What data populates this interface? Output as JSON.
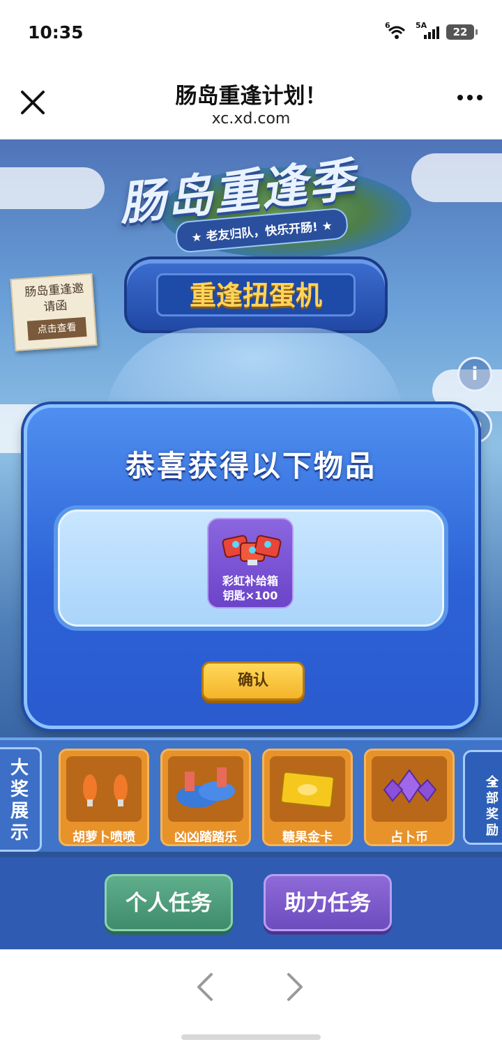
{
  "status_bar": {
    "time": "10:35",
    "wifi_label": "6",
    "cell_label": "5A",
    "battery": "22"
  },
  "header": {
    "title": "肠岛重逢计划！",
    "url": "xc.xd.com"
  },
  "banner": {
    "logo_title": "肠岛重逢季",
    "logo_subtitle": "★ 老友归队，快乐开肠! ★",
    "invite_title": "肠岛重逢邀请函",
    "invite_link": "点击查看",
    "machine_label": "重逢扭蛋机",
    "info_icon_glyph": "i",
    "history_icon_glyph": "⏲"
  },
  "modal": {
    "title": "恭喜获得以下物品",
    "reward": {
      "line1": "彩虹补给箱",
      "line2": "钥匙×100"
    },
    "confirm_label": "确认"
  },
  "prizes": {
    "side_label": "大奖展示",
    "all_label": "全部奖励",
    "all_arrow": "◂",
    "items": [
      {
        "name": "胡萝卜喷喷"
      },
      {
        "name": "凶凶踏踏乐"
      },
      {
        "name": "糖果金卡"
      },
      {
        "name": "占卜币"
      }
    ]
  },
  "tasks": {
    "personal": "个人任务",
    "assist": "助力任务"
  },
  "colors": {
    "modal_blue": "#2c62d6",
    "confirm_yellow": "#f4b42a",
    "prize_orange": "#e8922a",
    "task_green": "#3f8c6c",
    "task_purple": "#6c4cbe"
  }
}
